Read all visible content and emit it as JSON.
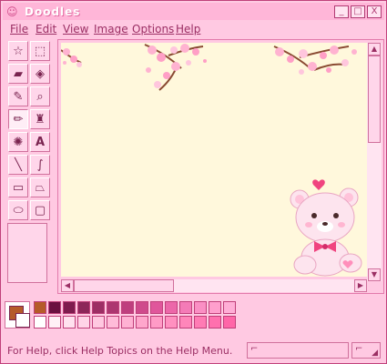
{
  "window": {
    "title": "Doodles",
    "title_icon": "smiley-icon"
  },
  "title_buttons": [
    {
      "name": "minimize-button",
      "glyph": "_"
    },
    {
      "name": "maximize-button",
      "glyph": "□"
    },
    {
      "name": "close-button",
      "glyph": "X"
    }
  ],
  "menu": {
    "items": [
      "File",
      "Edit",
      "View",
      "Image",
      "Options",
      "Help"
    ]
  },
  "tools": [
    {
      "name": "free-select-icon",
      "glyph": "☆"
    },
    {
      "name": "rect-select-icon",
      "glyph": "⬚"
    },
    {
      "name": "eraser-icon",
      "glyph": "▰"
    },
    {
      "name": "fill-bucket-icon",
      "glyph": "◈"
    },
    {
      "name": "color-picker-icon",
      "glyph": "✎"
    },
    {
      "name": "magnifier-icon",
      "glyph": "⌕"
    },
    {
      "name": "pencil-icon",
      "glyph": "✏",
      "pressed": true
    },
    {
      "name": "brush-icon",
      "glyph": "♜"
    },
    {
      "name": "airbrush-icon",
      "glyph": "✺"
    },
    {
      "name": "text-tool-icon",
      "glyph": "A"
    },
    {
      "name": "line-icon",
      "glyph": "╲"
    },
    {
      "name": "curve-icon",
      "glyph": "∫"
    },
    {
      "name": "rectangle-icon",
      "glyph": "▭"
    },
    {
      "name": "polygon-icon",
      "glyph": "⏢"
    },
    {
      "name": "ellipse-icon",
      "glyph": "⬭"
    },
    {
      "name": "rounded-rect-icon",
      "glyph": "▢"
    }
  ],
  "colors": {
    "foreground": "#b55b2a",
    "background": "#ffffff",
    "palette_top": [
      "#b55b2a",
      "#6a1040",
      "#7e1c4e",
      "#8c2659",
      "#9c2e64",
      "#ac3670",
      "#be3f7e",
      "#cf4a8c",
      "#e0569b",
      "#ec67a9",
      "#f47bb7",
      "#fa8fc4",
      "#ff9fcd",
      "#ffaed6"
    ],
    "palette_bottom": [
      "#ffffff",
      "#fff0f6",
      "#ffe1ee",
      "#ffd4e7",
      "#ffc8e0",
      "#ffbcd9",
      "#ffb1d3",
      "#ffa6cc",
      "#ff9bc6",
      "#ff90c0",
      "#ff86ba",
      "#ff7bb4",
      "#ff70ae",
      "#ff66a8"
    ]
  },
  "status": {
    "text": "For Help, click Help Topics on the Help Menu."
  }
}
